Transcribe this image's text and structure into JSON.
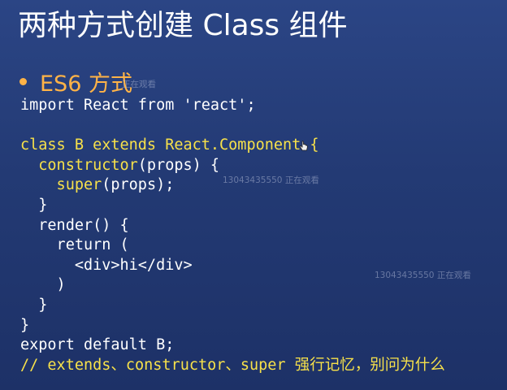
{
  "slide": {
    "title": "两种方式创建 Class 组件",
    "bullet": "ES6 方式"
  },
  "code": [
    [
      {
        "t": "import React from 'react';",
        "c": "white"
      }
    ],
    [],
    [
      {
        "t": "class B extends React.Component {",
        "c": "yellow"
      }
    ],
    [
      {
        "t": "  constructor",
        "c": "yellow"
      },
      {
        "t": "(props) {",
        "c": "white"
      }
    ],
    [
      {
        "t": "    super",
        "c": "yellow"
      },
      {
        "t": "(props);",
        "c": "white"
      }
    ],
    [
      {
        "t": "  }",
        "c": "white"
      }
    ],
    [
      {
        "t": "  render() {",
        "c": "white"
      }
    ],
    [
      {
        "t": "    return (",
        "c": "white"
      }
    ],
    [
      {
        "t": "      <div>hi</div>",
        "c": "white"
      }
    ],
    [
      {
        "t": "    )",
        "c": "white"
      }
    ],
    [
      {
        "t": "  }",
        "c": "white"
      }
    ],
    [
      {
        "t": "}",
        "c": "white"
      }
    ],
    [
      {
        "t": "export default B;",
        "c": "white"
      }
    ],
    [
      {
        "t": "// extends、constructor、super 强行记忆，别问为什么",
        "c": "yellow"
      }
    ]
  ],
  "watermarks": {
    "w1": "正在观看",
    "w2": "13043435550 正在观看",
    "w3": "13043435550 正在观看"
  },
  "colors": {
    "background": "#233a74",
    "title": "#ffffff",
    "accent": "#ffb347",
    "code_keyword": "#f7e14a",
    "code_text": "#ffffff"
  },
  "icons": {
    "cursor": "pointer-cursor-icon"
  }
}
